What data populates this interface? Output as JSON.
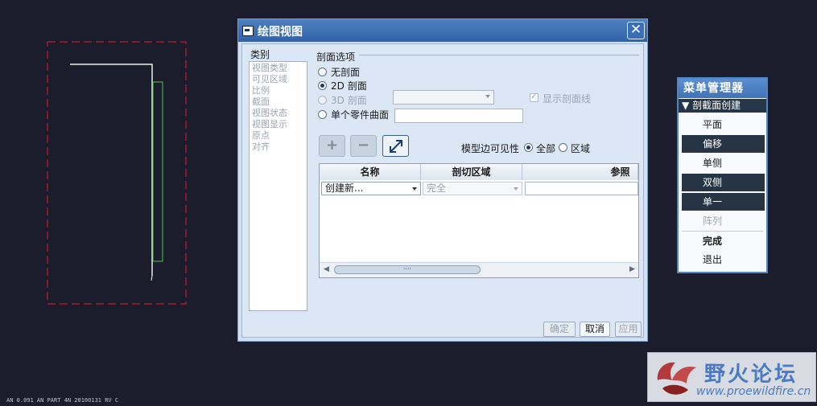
{
  "status_bar": {
    "text": "AN 0.091   AN PART   4N 20100131   RV C"
  },
  "dialog": {
    "title": "绘图视图",
    "close_label": "✕",
    "category_label": "类别",
    "categories": [
      "视图类型",
      "可见区域",
      "比例",
      "截面",
      "视图状态",
      "视图显示",
      "原点",
      "对齐"
    ],
    "section_options_title": "剖面选项",
    "options": [
      {
        "label": "无剖面",
        "checked": false,
        "enabled": true
      },
      {
        "label": "2D 剖面",
        "checked": true,
        "enabled": true
      },
      {
        "label": "3D 剖面",
        "checked": false,
        "enabled": false
      },
      {
        "label": "单个零件曲面",
        "checked": false,
        "enabled": true
      }
    ],
    "show_hatch_label": "显示剖面线",
    "show_hatch_checked": true,
    "toolbar": {
      "add_label": "+",
      "remove_label": "−",
      "flip_label": "↗"
    },
    "edge_visibility": {
      "label": "模型边可见性",
      "options": [
        {
          "label": "全部",
          "checked": true
        },
        {
          "label": "区域",
          "checked": false
        }
      ]
    },
    "table": {
      "columns": [
        "名称",
        "剖切区域",
        "参照"
      ],
      "rows": [
        {
          "name": "创建新...",
          "region": "完全",
          "reference": ""
        }
      ],
      "scroll_thumb_label": "····"
    },
    "buttons": {
      "ok_label": "确定",
      "cancel_label": "取消",
      "apply_label": "应用"
    }
  },
  "menu_manager": {
    "title": "菜单管理器",
    "submenu": "剖截面创建",
    "items": [
      {
        "label": "平面",
        "selected": false,
        "enabled": true
      },
      {
        "label": "偏移",
        "selected": true,
        "enabled": true
      },
      {
        "label": "单侧",
        "selected": false,
        "enabled": true
      },
      {
        "label": "双侧",
        "selected": true,
        "enabled": true
      },
      {
        "label": "单一",
        "selected": true,
        "enabled": true
      },
      {
        "label": "阵列",
        "selected": false,
        "enabled": false
      }
    ],
    "done_label": "完成",
    "quit_label": "退出"
  },
  "watermark": {
    "title": "野火论坛",
    "url": "www.proewildfire.cn"
  },
  "colors": {
    "canvas_bg": "#1b1d2c",
    "frame_red": "#e0202a",
    "edge_white": "#ffffff",
    "edge_green": "#5fd14a",
    "dialog_bg": "#dbe7f4",
    "title_blue": "#3568ad"
  }
}
